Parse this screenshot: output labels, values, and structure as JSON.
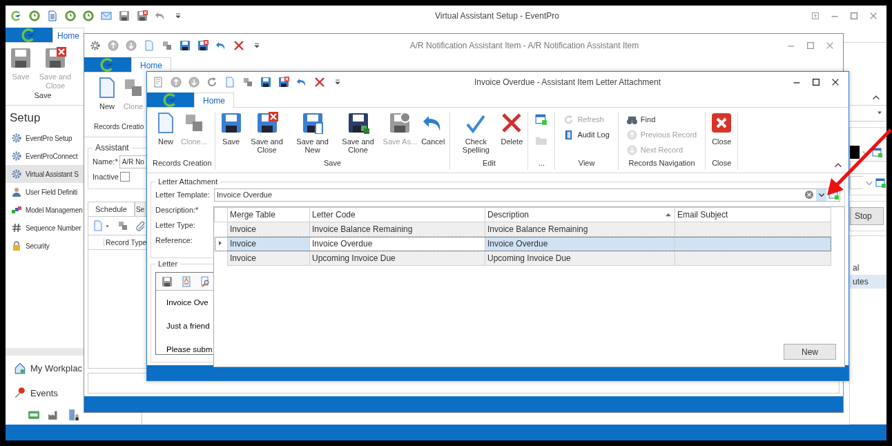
{
  "main_window": {
    "title": "Virtual Assistant Setup - EventPro",
    "tabs": [
      {
        "label": "Home",
        "selected": true
      }
    ],
    "ribbon_groups": [
      {
        "label": "Save",
        "buttons": [
          {
            "kind": "large",
            "label": "Save",
            "disabled": true
          },
          {
            "kind": "large",
            "label": "Save and Close",
            "disabled": true
          }
        ]
      }
    ],
    "sidebar": {
      "title": "Setup",
      "items": [
        {
          "label": "EventPro Setup",
          "selected": false
        },
        {
          "label": "EventProConnect",
          "selected": false
        },
        {
          "label": "Virtual Assistant S",
          "selected": true
        },
        {
          "label": "User Field Definiti",
          "selected": false
        },
        {
          "label": "Model Managemen",
          "selected": false
        },
        {
          "label": "Sequence Number",
          "selected": false
        },
        {
          "label": "Security",
          "selected": false
        }
      ],
      "nav": [
        {
          "label": "My Workplac"
        },
        {
          "label": "Events"
        }
      ]
    },
    "right_panel": {
      "button": "Stop",
      "list": [
        {
          "label": "al",
          "selected": false
        },
        {
          "label": "utes",
          "selected": true
        }
      ]
    }
  },
  "middle_window": {
    "title": "A/R Notification Assistant Item - A/R Notification Assistant Item",
    "tabs": [
      {
        "label": "Home",
        "selected": true
      }
    ],
    "ribbon_groups": [
      {
        "label": "Records Creatio",
        "buttons": [
          {
            "kind": "large",
            "label": "New",
            "disabled": false
          },
          {
            "kind": "large",
            "label": "Clone",
            "disabled": true
          }
        ]
      }
    ],
    "assistant": {
      "legend": "Assistant",
      "name_label": "Name:*",
      "name_value": "A/R No",
      "inactive_label": "Inactive",
      "inactive_checked": false
    },
    "tabs_lower": [
      {
        "label": "Schedule",
        "selected": true
      },
      {
        "label": "Se",
        "selected": false
      }
    ],
    "grid_column": "Record Type"
  },
  "front_window": {
    "title": "Invoice Overdue - Assistant Item Letter Attachment",
    "tabs": [
      {
        "label": "Home",
        "selected": true
      }
    ],
    "ribbon_groups": [
      {
        "label": "Records Creation",
        "buttons": [
          {
            "kind": "large",
            "label": "New",
            "disabled": false
          },
          {
            "kind": "large",
            "label": "Clone...",
            "disabled": true
          }
        ]
      },
      {
        "label": "Save",
        "buttons": [
          {
            "kind": "large",
            "label": "Save",
            "disabled": false
          },
          {
            "kind": "large",
            "label": "Save and Close",
            "disabled": false
          },
          {
            "kind": "large",
            "label": "Save and New",
            "disabled": false
          },
          {
            "kind": "large",
            "label": "Save and Clone",
            "disabled": false
          },
          {
            "kind": "large",
            "label": "Save As...",
            "disabled": true
          },
          {
            "kind": "large",
            "label": "Cancel",
            "disabled": false
          }
        ]
      },
      {
        "label": "Edit",
        "buttons": [
          {
            "kind": "large",
            "label": "Check Spelling",
            "disabled": false
          },
          {
            "kind": "large",
            "label": "Delete",
            "disabled": false
          }
        ]
      },
      {
        "label": "...",
        "buttons": [
          {
            "kind": "icon",
            "disabled": false
          },
          {
            "kind": "icon",
            "disabled": true
          }
        ]
      },
      {
        "label": "View",
        "buttons": [
          {
            "kind": "small",
            "label": "Refresh",
            "disabled": true
          },
          {
            "kind": "small",
            "label": "Audit Log",
            "disabled": false
          }
        ]
      },
      {
        "label": "Records Navigation",
        "buttons": [
          {
            "kind": "small",
            "label": "Find",
            "disabled": false
          },
          {
            "kind": "small",
            "label": "Previous Record",
            "disabled": true
          },
          {
            "kind": "small",
            "label": "Next Record",
            "disabled": true
          }
        ]
      },
      {
        "label": "Close",
        "buttons": [
          {
            "kind": "large",
            "label": "Close",
            "disabled": false
          }
        ]
      }
    ],
    "letter_attachment": {
      "legend": "Letter Attachment",
      "fields": [
        {
          "label": "Letter Template:"
        },
        {
          "label": "Description:*"
        },
        {
          "label": "Letter Type:"
        },
        {
          "label": "Reference:"
        }
      ],
      "template_value": "Invoice Overdue",
      "dropdown": {
        "columns": [
          {
            "label": "Merge Table",
            "sorted_ascending": false
          },
          {
            "label": "Letter Code",
            "sorted_ascending": false
          },
          {
            "label": "Description",
            "sorted_ascending": true
          },
          {
            "label": "Email Subject",
            "sorted_ascending": false
          }
        ],
        "rows": [
          {
            "merge_table": "Invoice",
            "letter_code": "Invoice Balance Remaining",
            "description": "Invoice Balance Remaining",
            "selected": false
          },
          {
            "merge_table": "Invoice",
            "letter_code": "Invoice Overdue",
            "description": "Invoice Overdue",
            "selected": true
          },
          {
            "merge_table": "Invoice",
            "letter_code": "Upcoming Invoice Due",
            "description": "Upcoming Invoice Due",
            "selected": false
          }
        ],
        "new_button": "New"
      }
    },
    "letter": {
      "legend": "Letter",
      "lines": [
        "Invoice Ove",
        "Just a friend",
        "Please subm"
      ]
    }
  }
}
